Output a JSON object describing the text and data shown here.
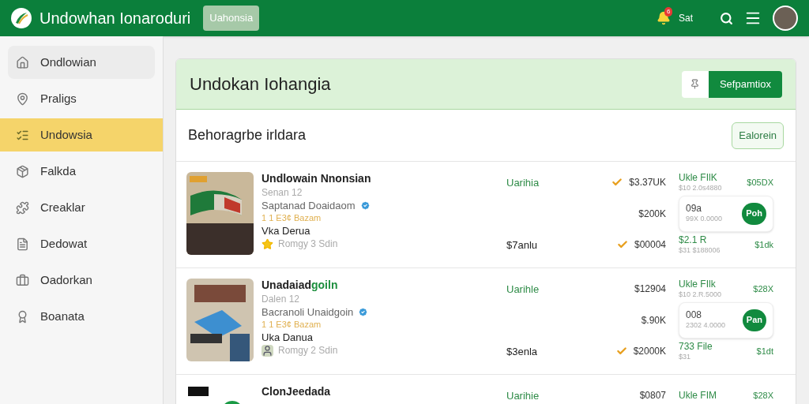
{
  "header": {
    "title": "Undowhan Ionaroduri",
    "badge": "Uahonsia",
    "notification_count": "6",
    "day": "Sat"
  },
  "sidebar": {
    "items": [
      {
        "label": "Ondlowian",
        "selected": false,
        "hovered": true
      },
      {
        "label": "Praligs",
        "selected": false,
        "hovered": false
      },
      {
        "label": "Undowsia",
        "selected": true,
        "hovered": false
      },
      {
        "label": "Falkda",
        "selected": false,
        "hovered": false
      },
      {
        "label": "Creaklar",
        "selected": false,
        "hovered": false
      },
      {
        "label": "Dedowat",
        "selected": false,
        "hovered": false
      },
      {
        "label": "Oadorkan",
        "selected": false,
        "hovered": false
      },
      {
        "label": "Boanata",
        "selected": false,
        "hovered": false
      }
    ]
  },
  "panel": {
    "title": "Undokan Iohangia",
    "primary_button": "Sefpamtiox",
    "section_title": "Behoragrbe irldara",
    "section_button": "Ealorein",
    "rows": [
      {
        "title": "Undlowain Nnonsian",
        "subtitle": "Senan 12",
        "seller": "Saptanad Doaidaom",
        "verified": true,
        "tag": "1 1 E3¢ Bazam",
        "name": "Vka Derua",
        "rating": {
          "kind": "star",
          "text": "Romgy 3 Sdin"
        },
        "lines": [
          {
            "left": {
              "kind": "status",
              "text": "Uarihia"
            },
            "amount": "$3.37UK",
            "checked": true,
            "offer": {
              "kind": "plain",
              "label": "Ukle FIlK",
              "sub": "$10 2.0s4880",
              "value": "$05DX"
            }
          },
          {
            "amount": "$200K",
            "checked": false,
            "offer": {
              "kind": "boxed",
              "label": "09a",
              "sub": "99X 0.0000",
              "value": "Poh"
            }
          },
          {
            "left": {
              "kind": "price",
              "text": "$7anlu"
            },
            "amount": "$00004",
            "checked": true,
            "offer": {
              "kind": "plain",
              "label": "$2.1 R",
              "sub": "$31 $188006",
              "value": "$1dk"
            }
          }
        ]
      },
      {
        "title": "Unadaiad",
        "title_accent": "goiln",
        "subtitle": "Dalen 12",
        "seller": "Bacranoli Unaidgoin",
        "verified": true,
        "tag": "1 1 E3¢ Bazam",
        "name": "Uka Danua",
        "rating": {
          "kind": "avatar",
          "text": "Romgy 2 Sdin"
        },
        "lines": [
          {
            "left": {
              "kind": "status",
              "text": "Uarihle"
            },
            "amount": "$12904",
            "checked": false,
            "offer": {
              "kind": "plain",
              "label": "Ukle FIlk",
              "sub": "$10 2.R.5000",
              "value": "$28X"
            }
          },
          {
            "amount": "$.90K",
            "checked": false,
            "offer": {
              "kind": "boxed",
              "label": "008",
              "sub": "2302 4.0000",
              "value": "Pan"
            }
          },
          {
            "left": {
              "kind": "price",
              "text": "$3enla"
            },
            "amount": "$2000K",
            "checked": true,
            "offer": {
              "kind": "plain",
              "label": "733 File",
              "sub": "$31",
              "value": "$1dt"
            }
          }
        ]
      },
      {
        "title": "ClonJeedada",
        "lines": [
          {
            "left": {
              "kind": "status",
              "text": "Uarihie"
            },
            "amount": "$0807",
            "checked": false,
            "offer": {
              "kind": "plain",
              "label": "Ukle FIM",
              "value": "$28X"
            }
          }
        ]
      }
    ]
  }
}
